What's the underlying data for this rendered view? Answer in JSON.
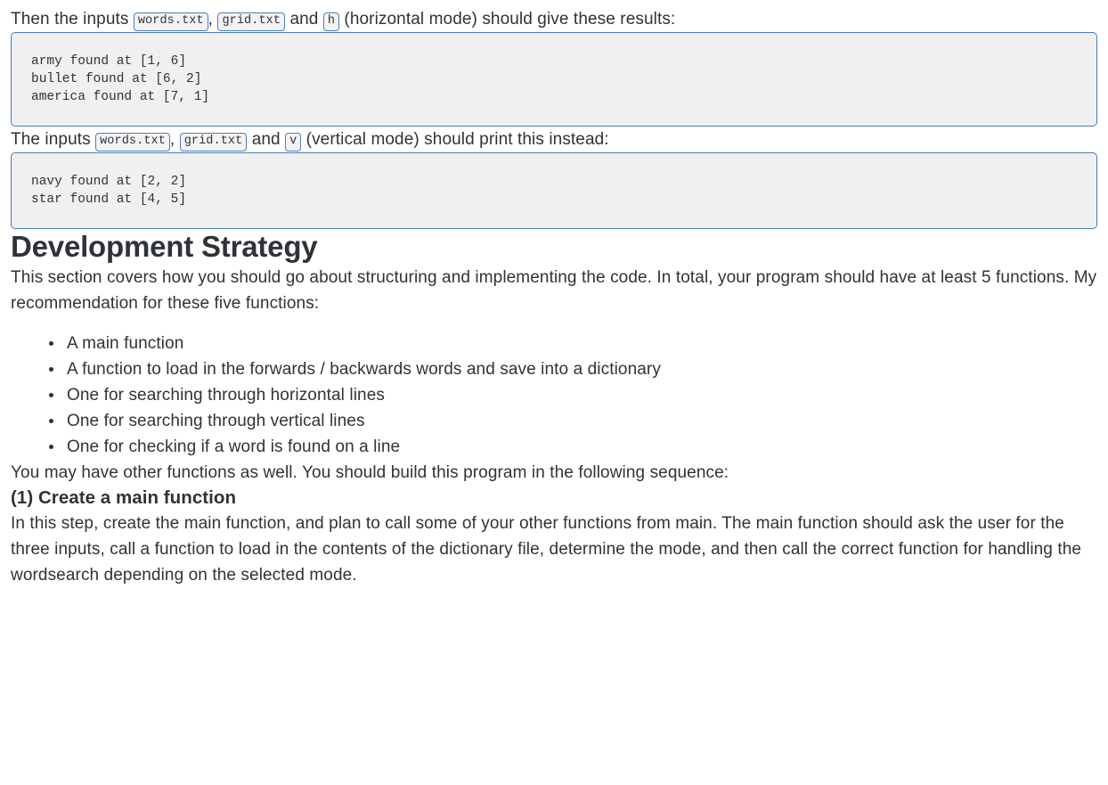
{
  "document": {
    "intro_horizontal": {
      "text_before": "Then the inputs ",
      "code_1": "words.txt",
      "separator": ", ",
      "code_2": "grid.txt",
      "text_mid": " and ",
      "code_3": "h",
      "text_after": " (horizontal mode) should give these results:"
    },
    "output_horizontal": "army found at [1, 6]\nbullet found at [6, 2]\namerica found at [7, 1]",
    "intro_vertical": {
      "text_before": "The inputs ",
      "code_1": "words.txt",
      "separator": ", ",
      "code_2": "grid.txt",
      "text_mid": " and ",
      "code_3": "v",
      "text_after": " (vertical mode) should print this instead:"
    },
    "output_vertical": "navy found at [2, 2]\nstar found at [4, 5]",
    "section_heading": "Development Strategy",
    "section_intro": "This section covers how you should go about structuring and implementing the code. In total, your program should have at least 5 functions. My recommendation for these five functions:",
    "function_list": [
      "A main function",
      "A function to load in the forwards / backwards words and save into a dictionary",
      "One for searching through horizontal lines",
      "One for searching through vertical lines",
      "One for checking if a word is found on a line"
    ],
    "sequence_note": "You may have other functions as well. You should build this program in the following sequence:",
    "step_one_heading": "(1) Create a main function",
    "step_one_body": "In this step, create the main function, and plan to call some of your other functions from main. The main function should ask the user for the three inputs, call a function to load in the contents of the dictionary file, determine the mode, and then call the correct function for handling the wordsearch depending on the selected mode."
  },
  "colors": {
    "code_border": "#4a7ebb",
    "code_background": "#f0f0f0",
    "text": "#2f3337"
  }
}
